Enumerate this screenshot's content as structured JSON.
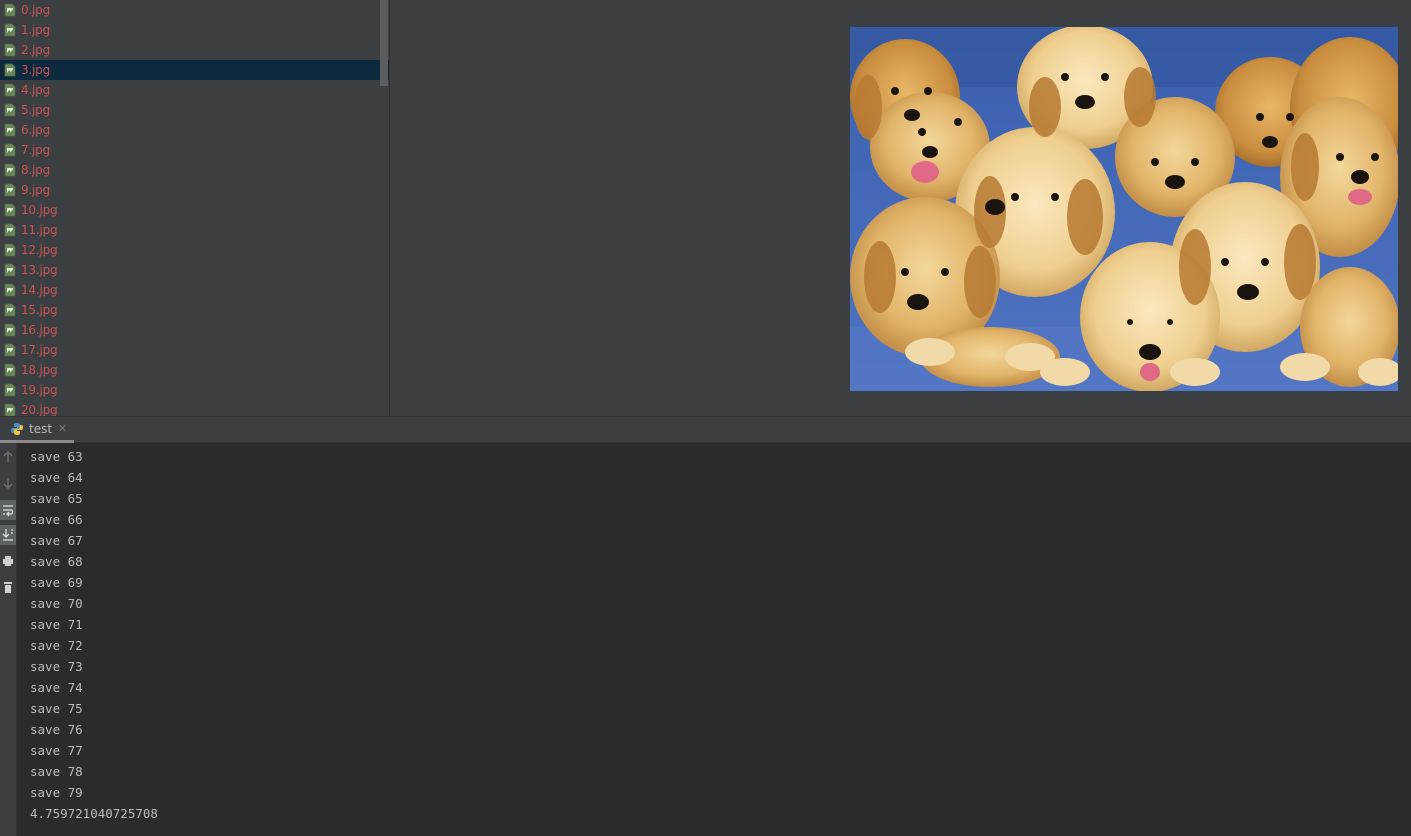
{
  "project_tree": {
    "files": [
      {
        "name": "0.jpg"
      },
      {
        "name": "1.jpg"
      },
      {
        "name": "2.jpg"
      },
      {
        "name": "3.jpg",
        "selected": true
      },
      {
        "name": "4.jpg"
      },
      {
        "name": "5.jpg"
      },
      {
        "name": "6.jpg"
      },
      {
        "name": "7.jpg"
      },
      {
        "name": "8.jpg"
      },
      {
        "name": "9.jpg"
      },
      {
        "name": "10.jpg"
      },
      {
        "name": "11.jpg"
      },
      {
        "name": "12.jpg"
      },
      {
        "name": "13.jpg"
      },
      {
        "name": "14.jpg"
      },
      {
        "name": "15.jpg"
      },
      {
        "name": "16.jpg"
      },
      {
        "name": "17.jpg"
      },
      {
        "name": "18.jpg"
      },
      {
        "name": "19.jpg"
      },
      {
        "name": "20.jpg"
      }
    ],
    "file_icon": "image-file-icon",
    "file_name_color": "#c75450",
    "selection_color": "#0d293e"
  },
  "image_viewer": {
    "image": "puppies-photo",
    "content": "litter of golden retriever puppies on a blue cushion"
  },
  "run_panel": {
    "tab_label": "test",
    "tab_icon": "python-icon",
    "close_glyph": "✕",
    "toolbar_icons": [
      "up-arrow-icon",
      "down-arrow-icon",
      "soft-wrap-icon",
      "scroll-to-end-icon",
      "print-icon",
      "trash-icon"
    ],
    "console_lines": [
      "save 63",
      "save 64",
      "save 65",
      "save 66",
      "save 67",
      "save 68",
      "save 69",
      "save 70",
      "save 71",
      "save 72",
      "save 73",
      "save 74",
      "save 75",
      "save 76",
      "save 77",
      "save 78",
      "save 79",
      "4.759721040725708"
    ]
  },
  "colors": {
    "panel_bg": "#3c3f41",
    "console_bg": "#2b2b2b",
    "console_text": "#bbbbbb"
  }
}
